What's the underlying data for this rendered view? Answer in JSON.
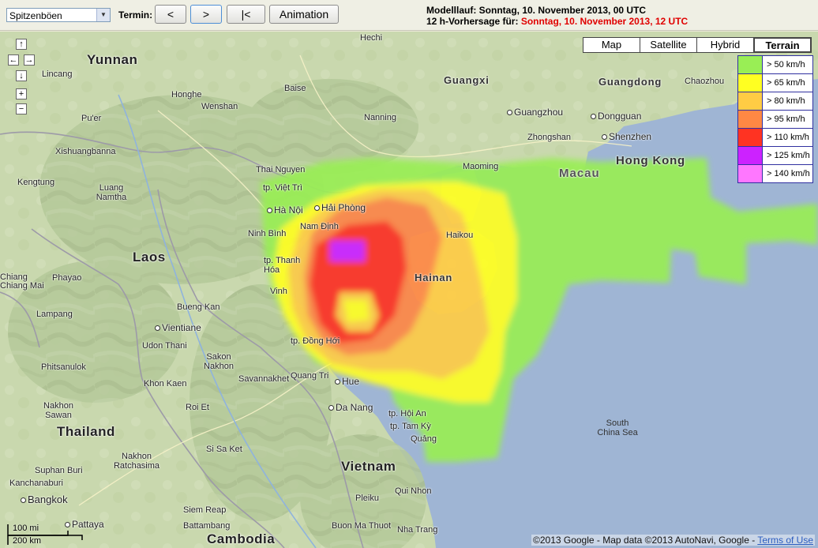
{
  "toolbar": {
    "product": "Spitzenböen",
    "termin_label": "Termin:",
    "prev_label": "<",
    "next_label": ">",
    "first_label": "|<",
    "animation_label": "Animation"
  },
  "run_info": {
    "run_label": "Modelllauf: Sonntag, 10. November 2013, 00 UTC",
    "forecast_label": "12 h-Vorhersage für: ",
    "forecast_value": "Sonntag, 10. November 2013, 12 UTC"
  },
  "map_types": [
    "Map",
    "Satellite",
    "Hybrid",
    "Terrain"
  ],
  "map_type_selected": "Terrain",
  "legend": [
    {
      "label": "> 50 km/h",
      "color": "#99ee55"
    },
    {
      "label": "> 65 km/h",
      "color": "#ffff22"
    },
    {
      "label": "> 80 km/h",
      "color": "#ffcc44"
    },
    {
      "label": "> 95 km/h",
      "color": "#ff8844"
    },
    {
      "label": "> 110 km/h",
      "color": "#ff3322"
    },
    {
      "label": "> 125 km/h",
      "color": "#cc22ff"
    },
    {
      "label": "> 140 km/h",
      "color": "#ff77ff"
    }
  ],
  "places": {
    "countries": [
      "Laos",
      "Thailand",
      "Vietnam",
      "Cambodia"
    ],
    "provinces": [
      "Yunnan",
      "Guangxi",
      "Guangdong",
      "Hainan",
      "Hong Kong",
      "Macau"
    ],
    "cities": [
      "Hechi",
      "Lincang",
      "Honghe",
      "Wenshan",
      "Pu'er",
      "Baise",
      "Nanning",
      "Guangzhou",
      "Dongguan",
      "Zhongshan",
      "Shenzhen",
      "Chaozhou",
      "Xishuangbanna",
      "Kengtung",
      "Luang Namtha",
      "Thai Nguyen",
      "tp. Việt Trì",
      "Hà Nội",
      "Hải Phòng",
      "Nam Định",
      "Ninh Bình",
      "Maoming",
      "Haikou",
      "tp. Thanh Hóa",
      "Vinh",
      "Phayao",
      "Lampang",
      "Bueng Kan",
      "Vientiane",
      "Udon Thani",
      "Sakon Nakhon",
      "Savannakhet",
      "Khon Kaen",
      "Roi Et",
      "tp. Đồng Hới",
      "Quang Tri",
      "Hue",
      "Da Nang",
      "tp. Hội An",
      "tp. Tam Kỳ",
      "Quảng",
      "Phitsanulok",
      "Nakhon Sawan",
      "Nakhon Ratchasima",
      "Si Sa Ket",
      "Suphan Buri",
      "Kanchanaburi",
      "Bangkok",
      "Pattaya",
      "Siem Reap",
      "Battambang",
      "Pleiku",
      "Qui Nhon",
      "Buon Ma Thuot",
      "Nha Trang",
      "Chiang Mai",
      "Chiang"
    ],
    "sea": "South China Sea"
  },
  "scale": {
    "mi": "100 mi",
    "km": "200 km"
  },
  "copyright": {
    "text": "©2013 Google - Map data ©2013 AutoNavi, Google - ",
    "link": "Terms of Use"
  },
  "icons": [
    "dropdown-arrow-icon",
    "pan-up-icon",
    "pan-left-icon",
    "pan-right-icon",
    "pan-down-icon",
    "zoom-in-icon",
    "zoom-out-icon"
  ]
}
